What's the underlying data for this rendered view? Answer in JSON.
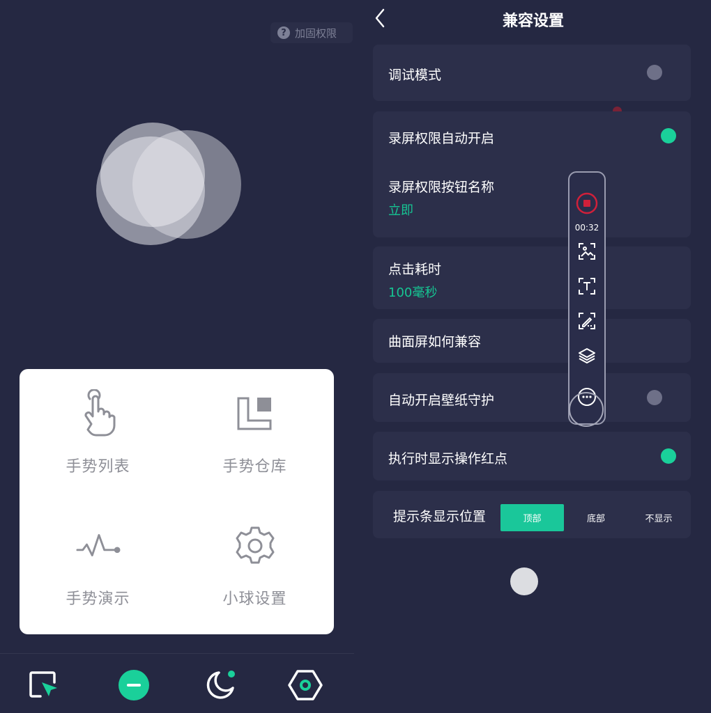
{
  "left": {
    "permission_button": "加固权限",
    "help_icon_char": "?",
    "menu": [
      {
        "icon": "tap-hand-icon",
        "label": "手势列表"
      },
      {
        "icon": "warehouse-icon",
        "label": "手势仓库"
      },
      {
        "icon": "pulse-wave-icon",
        "label": "手势演示"
      },
      {
        "icon": "gear-icon",
        "label": "小球设置"
      }
    ],
    "bottom_tabs": [
      {
        "icon": "pointer-square-icon",
        "active": false
      },
      {
        "icon": "minus-circle-icon",
        "active": true
      },
      {
        "icon": "moon-icon",
        "active": false
      },
      {
        "icon": "hexagon-icon",
        "active": false
      }
    ]
  },
  "right": {
    "title": "兼容设置",
    "rows": {
      "debug_mode": {
        "label": "调试模式",
        "enabled": false
      },
      "screen_record_auto": {
        "label": "录屏权限自动开启",
        "enabled": true
      },
      "screen_record_button_name": {
        "label": "录屏权限按钮名称",
        "value": "立即"
      },
      "click_duration": {
        "label": "点击耗时",
        "value": "100毫秒"
      },
      "curved_screen": {
        "label": "曲面屏如何兼容"
      },
      "wallpaper_guard": {
        "label": "自动开启壁纸守护",
        "enabled": false
      },
      "show_red_dot": {
        "label": "执行时显示操作红点",
        "enabled": true
      }
    },
    "hint_bar": {
      "label": "提示条显示位置",
      "options": [
        "顶部",
        "底部",
        "不显示"
      ],
      "selected": "顶部"
    },
    "floating_toolbar": {
      "timer": "00:32",
      "tools": [
        "stop-record-icon",
        "image-scan-icon",
        "text-scan-icon",
        "edit-scan-icon",
        "layers-icon",
        "more-icon"
      ]
    }
  },
  "colors": {
    "background": "#252842",
    "card": "#2c2f4a",
    "accent": "#1ad09a",
    "toggle_off": "#6e7088",
    "record_red": "#d0203a"
  }
}
